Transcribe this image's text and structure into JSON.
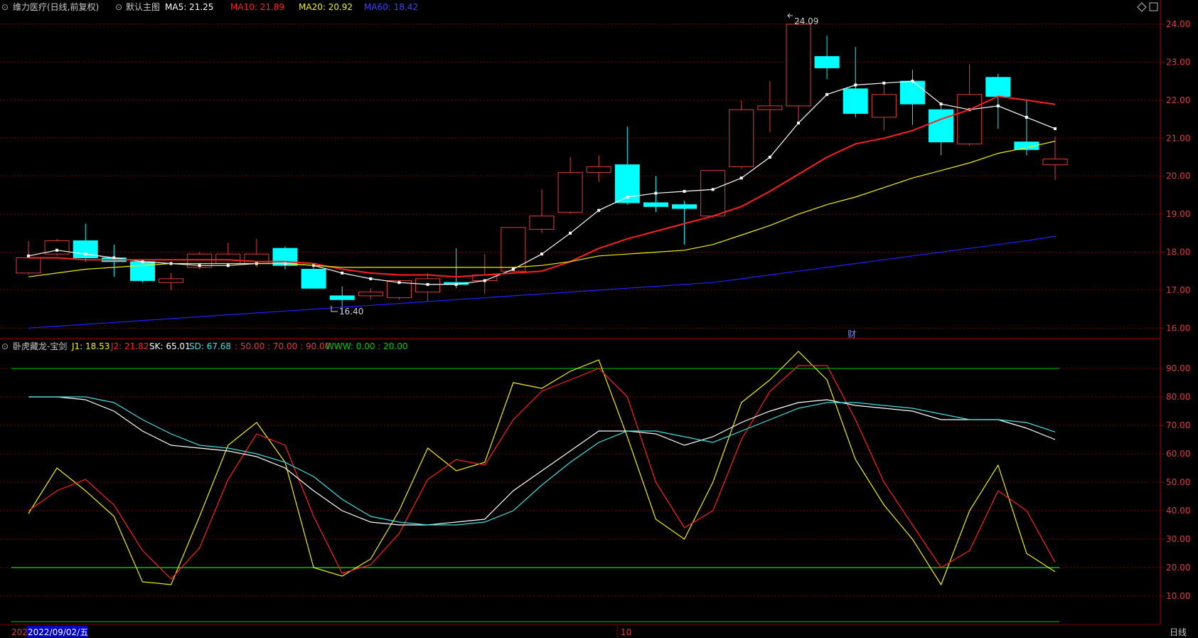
{
  "colors": {
    "bg": "#000000",
    "grid": "#7a0000",
    "axis_text": "#e03c3c",
    "up": "#e03c3c",
    "down": "#00ffff",
    "ma5": "#ffffff",
    "ma10": "#ff2020",
    "ma20": "#f0f000",
    "ma60": "#2020ff",
    "j1": "#f0f000",
    "j2": "#ff2020",
    "sk": "#ffffff",
    "sd": "#40e0e0",
    "ref_line": "#00c800",
    "label_text": "#c8c8c8"
  },
  "header": {
    "stock": "维力医疗(日线,前复权)",
    "preset": "默认主图",
    "ma5_label": "MA5: 21.25",
    "ma10_label": "MA10: 21.89",
    "ma20_label": "MA20: 20.92",
    "ma60_label": "MA60: 18.42"
  },
  "indicator_header": {
    "name": "卧虎藏龙-宝剑",
    "j1_label": "J1: 18.53",
    "j2_label": "J2: 21.82",
    "sk_label": "SK: 65.01",
    "sd_label": "SD: 67.68",
    "levels_text": ": 50.00 : 70.00 : 90.00",
    "www_label": "WWW: 0.00 : 20.00"
  },
  "toolbar_icons": [
    "diamond-icon",
    "grid-icon"
  ],
  "bottom_bar": {
    "year_partial": "202",
    "cursor_date": "2022/09/02/五",
    "month_marker": "10",
    "period": "日线"
  },
  "annotations": {
    "high": "24.09",
    "low": "16.40",
    "event_marker": "财"
  },
  "chart_data": [
    {
      "type": "candlestick",
      "title": "维力医疗(日线,前复权)",
      "ylim": [
        15.8,
        24.3
      ],
      "y_ticks": [
        "16.00",
        "17.00",
        "18.00",
        "19.00",
        "20.00",
        "21.00",
        "22.00",
        "23.00",
        "24.00"
      ],
      "candles": [
        {
          "o": 17.45,
          "h": 18.3,
          "l": 17.4,
          "c": 17.85
        },
        {
          "o": 17.95,
          "h": 18.35,
          "l": 17.9,
          "c": 18.3
        },
        {
          "o": 18.3,
          "h": 18.75,
          "l": 17.75,
          "c": 17.85
        },
        {
          "o": 17.85,
          "h": 18.2,
          "l": 17.35,
          "c": 17.75
        },
        {
          "o": 17.75,
          "h": 17.8,
          "l": 17.2,
          "c": 17.25
        },
        {
          "o": 17.2,
          "h": 17.45,
          "l": 17.0,
          "c": 17.3
        },
        {
          "o": 17.6,
          "h": 18.0,
          "l": 17.55,
          "c": 17.95
        },
        {
          "o": 17.7,
          "h": 18.25,
          "l": 17.6,
          "c": 17.95
        },
        {
          "o": 17.7,
          "h": 18.35,
          "l": 17.6,
          "c": 17.95
        },
        {
          "o": 18.1,
          "h": 18.15,
          "l": 17.55,
          "c": 17.65
        },
        {
          "o": 17.55,
          "h": 17.6,
          "l": 17.05,
          "c": 17.05
        },
        {
          "o": 16.85,
          "h": 17.1,
          "l": 16.4,
          "c": 16.75
        },
        {
          "o": 16.85,
          "h": 17.05,
          "l": 16.75,
          "c": 16.95
        },
        {
          "o": 16.8,
          "h": 17.2,
          "l": 16.75,
          "c": 17.25
        },
        {
          "o": 16.95,
          "h": 17.45,
          "l": 16.7,
          "c": 17.3
        },
        {
          "o": 17.2,
          "h": 18.1,
          "l": 17.05,
          "c": 17.15
        },
        {
          "o": 17.25,
          "h": 17.95,
          "l": 16.9,
          "c": 17.4
        },
        {
          "o": 17.5,
          "h": 18.6,
          "l": 17.5,
          "c": 18.65
        },
        {
          "o": 18.6,
          "h": 19.65,
          "l": 18.5,
          "c": 18.95
        },
        {
          "o": 19.05,
          "h": 20.5,
          "l": 19.0,
          "c": 20.1
        },
        {
          "o": 20.1,
          "h": 20.55,
          "l": 19.85,
          "c": 20.25
        },
        {
          "o": 20.3,
          "h": 21.3,
          "l": 19.25,
          "c": 19.3
        },
        {
          "o": 19.3,
          "h": 20.0,
          "l": 19.05,
          "c": 19.2
        },
        {
          "o": 19.25,
          "h": 19.35,
          "l": 18.2,
          "c": 19.15
        },
        {
          "o": 18.95,
          "h": 20.1,
          "l": 18.9,
          "c": 20.15
        },
        {
          "o": 20.25,
          "h": 22.0,
          "l": 20.2,
          "c": 21.75
        },
        {
          "o": 21.75,
          "h": 22.5,
          "l": 21.15,
          "c": 21.85
        },
        {
          "o": 21.85,
          "h": 24.09,
          "l": 21.45,
          "c": 24.0
        },
        {
          "o": 23.15,
          "h": 23.7,
          "l": 22.55,
          "c": 22.85
        },
        {
          "o": 22.3,
          "h": 23.4,
          "l": 21.55,
          "c": 21.65
        },
        {
          "o": 21.55,
          "h": 22.4,
          "l": 21.2,
          "c": 22.15
        },
        {
          "o": 22.5,
          "h": 22.8,
          "l": 21.35,
          "c": 21.9
        },
        {
          "o": 21.75,
          "h": 21.9,
          "l": 20.55,
          "c": 20.9
        },
        {
          "o": 20.85,
          "h": 22.95,
          "l": 20.8,
          "c": 22.15
        },
        {
          "o": 22.6,
          "h": 22.7,
          "l": 21.25,
          "c": 22.1
        },
        {
          "o": 20.9,
          "h": 22.0,
          "l": 20.55,
          "c": 20.7
        },
        {
          "o": 20.3,
          "h": 21.05,
          "l": 19.9,
          "c": 20.45
        }
      ],
      "series": [
        {
          "name": "MA5",
          "values": [
            17.9,
            18.05,
            17.95,
            17.85,
            17.75,
            17.7,
            17.65,
            17.65,
            17.7,
            17.7,
            17.65,
            17.45,
            17.3,
            17.2,
            17.15,
            17.15,
            17.25,
            17.55,
            17.95,
            18.5,
            19.1,
            19.45,
            19.55,
            19.6,
            19.65,
            19.95,
            20.5,
            21.4,
            22.15,
            22.4,
            22.45,
            22.5,
            21.9,
            21.75,
            21.85,
            21.55,
            21.25
          ]
        },
        {
          "name": "MA10",
          "values": [
            17.85,
            17.85,
            17.8,
            17.8,
            17.8,
            17.8,
            17.8,
            17.8,
            17.75,
            17.75,
            17.7,
            17.55,
            17.45,
            17.4,
            17.4,
            17.35,
            17.4,
            17.45,
            17.5,
            17.75,
            18.1,
            18.35,
            18.55,
            18.75,
            18.95,
            19.2,
            19.6,
            20.05,
            20.5,
            20.85,
            21.0,
            21.2,
            21.5,
            21.75,
            22.1,
            22.0,
            21.89
          ]
        },
        {
          "name": "MA20",
          "values": [
            17.35,
            17.45,
            17.55,
            17.6,
            17.65,
            17.7,
            17.7,
            17.7,
            17.7,
            17.7,
            17.65,
            17.6,
            17.6,
            17.6,
            17.6,
            17.6,
            17.6,
            17.6,
            17.65,
            17.75,
            17.9,
            17.95,
            18.0,
            18.05,
            18.2,
            18.45,
            18.7,
            19.0,
            19.25,
            19.45,
            19.7,
            19.95,
            20.15,
            20.35,
            20.6,
            20.75,
            20.92
          ]
        },
        {
          "name": "MA60",
          "values": [
            16.0,
            16.05,
            16.1,
            16.15,
            16.2,
            16.25,
            16.3,
            16.35,
            16.4,
            16.45,
            16.5,
            16.55,
            16.6,
            16.65,
            16.7,
            16.75,
            16.8,
            16.85,
            16.9,
            16.95,
            17.0,
            17.05,
            17.1,
            17.15,
            17.2,
            17.3,
            17.4,
            17.5,
            17.6,
            17.7,
            17.8,
            17.9,
            18.0,
            18.1,
            18.2,
            18.3,
            18.42
          ]
        }
      ]
    },
    {
      "type": "line",
      "title": "卧虎藏龙-宝剑",
      "ylim": [
        0,
        100
      ],
      "y_ticks": [
        "10.00",
        "20.00",
        "30.00",
        "40.00",
        "50.00",
        "60.00",
        "70.00",
        "80.00",
        "90.00"
      ],
      "series": [
        {
          "name": "J1",
          "values": [
            39,
            55,
            47,
            38,
            15,
            14,
            38,
            63,
            71,
            57,
            20,
            17,
            23,
            40,
            62,
            54,
            57,
            85,
            83,
            89,
            93,
            66,
            37,
            30,
            50,
            78,
            86,
            96,
            86,
            58,
            42,
            30,
            14,
            40,
            56,
            25,
            18.53
          ]
        },
        {
          "name": "J2",
          "values": [
            40,
            47,
            51,
            42,
            26,
            16,
            27,
            51,
            67,
            63,
            38,
            18,
            21,
            32,
            51,
            58,
            56,
            72,
            82,
            86,
            90,
            80,
            50,
            34,
            40,
            65,
            82,
            91,
            91,
            72,
            50,
            35,
            20,
            26,
            47,
            40,
            21.82
          ]
        },
        {
          "name": "SK",
          "values": [
            80,
            80,
            79,
            75,
            68,
            63,
            62,
            61,
            59,
            55,
            47,
            40,
            36,
            35,
            35,
            36,
            37,
            47,
            54,
            61,
            68,
            68,
            67,
            63,
            66,
            71,
            75,
            78,
            79,
            77,
            76,
            75,
            72,
            72,
            72,
            69,
            65.01
          ]
        },
        {
          "name": "SD",
          "values": [
            80,
            80,
            80,
            78,
            72,
            67,
            63,
            62,
            60,
            57,
            52,
            44,
            38,
            36,
            35,
            35,
            36,
            40,
            49,
            57,
            64,
            68,
            68,
            66,
            64,
            68,
            72,
            76,
            78,
            78,
            77,
            76,
            74,
            72,
            72,
            71,
            67.68
          ]
        }
      ],
      "levels": [
        50,
        70,
        90,
        0,
        20
      ]
    }
  ]
}
